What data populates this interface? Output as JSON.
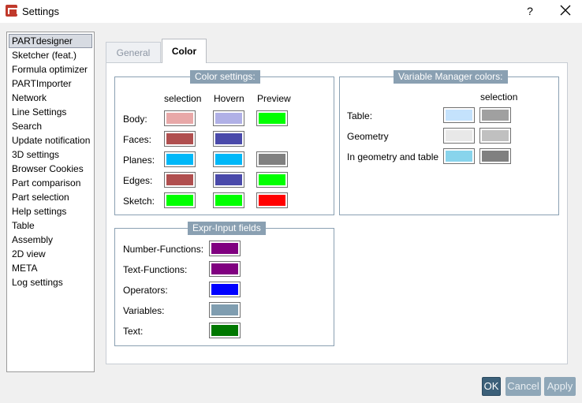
{
  "window": {
    "title": "Settings",
    "help_label": "?"
  },
  "sidebar": {
    "items": [
      {
        "label": "PARTdesigner",
        "selected": true
      },
      {
        "label": "Sketcher (feat.)"
      },
      {
        "label": "Formula optimizer"
      },
      {
        "label": "PARTImporter"
      },
      {
        "label": "Network"
      },
      {
        "label": "Line Settings"
      },
      {
        "label": "Search"
      },
      {
        "label": "Update notification"
      },
      {
        "label": "3D settings"
      },
      {
        "label": "Browser Cookies"
      },
      {
        "label": "Part comparison"
      },
      {
        "label": "Part selection"
      },
      {
        "label": "Help settings"
      },
      {
        "label": "Table"
      },
      {
        "label": "Assembly"
      },
      {
        "label": "2D view"
      },
      {
        "label": "META"
      },
      {
        "label": "Log settings"
      }
    ]
  },
  "tabs": {
    "general": "General",
    "color": "Color",
    "active": "Color"
  },
  "color_settings": {
    "title": "Color settings:",
    "headers": {
      "selection": "selection",
      "hovern": "Hovern",
      "preview": "Preview"
    },
    "rows": [
      {
        "label": "Body:",
        "selection": "#e8a8a8",
        "hovern": "#b0b0e6",
        "preview": "#00ff00"
      },
      {
        "label": "Faces:",
        "selection": "#b04f4f",
        "hovern": "#4a4aaa",
        "preview": null
      },
      {
        "label": "Planes:",
        "selection": "#00b8f8",
        "hovern": "#00b8f8",
        "preview": "#808080"
      },
      {
        "label": "Edges:",
        "selection": "#b04f4f",
        "hovern": "#4a4aaa",
        "preview": "#00ff00"
      },
      {
        "label": "Sketch:",
        "selection": "#00ff00",
        "hovern": "#00ff00",
        "preview": "#ff0000"
      }
    ]
  },
  "variable_manager": {
    "title": "Variable Manager colors:",
    "header_selection": "selection",
    "rows": [
      {
        "label": "Table:",
        "color": "#c4e2fc",
        "selection": "#a0a0a0"
      },
      {
        "label": "Geometry",
        "color": "#e8e8e8",
        "selection": "#c0c0c0"
      },
      {
        "label": "In geometry and table",
        "color": "#88d4ec",
        "selection": "#808080"
      }
    ]
  },
  "expr_input": {
    "title": "Expr-Input fields",
    "rows": [
      {
        "label": "Number-Functions:",
        "color": "#800080"
      },
      {
        "label": "Text-Functions:",
        "color": "#800080"
      },
      {
        "label": "Operators:",
        "color": "#0000ff"
      },
      {
        "label": "Variables:",
        "color": "#7f9db0"
      },
      {
        "label": "Text:",
        "color": "#007800"
      }
    ]
  },
  "buttons": {
    "ok": "OK",
    "cancel": "Cancel",
    "apply": "Apply"
  },
  "colors": {
    "group_border": "#8aa0b2",
    "ok_button": "#3c6079",
    "disabled_button": "#8fa7b8"
  }
}
